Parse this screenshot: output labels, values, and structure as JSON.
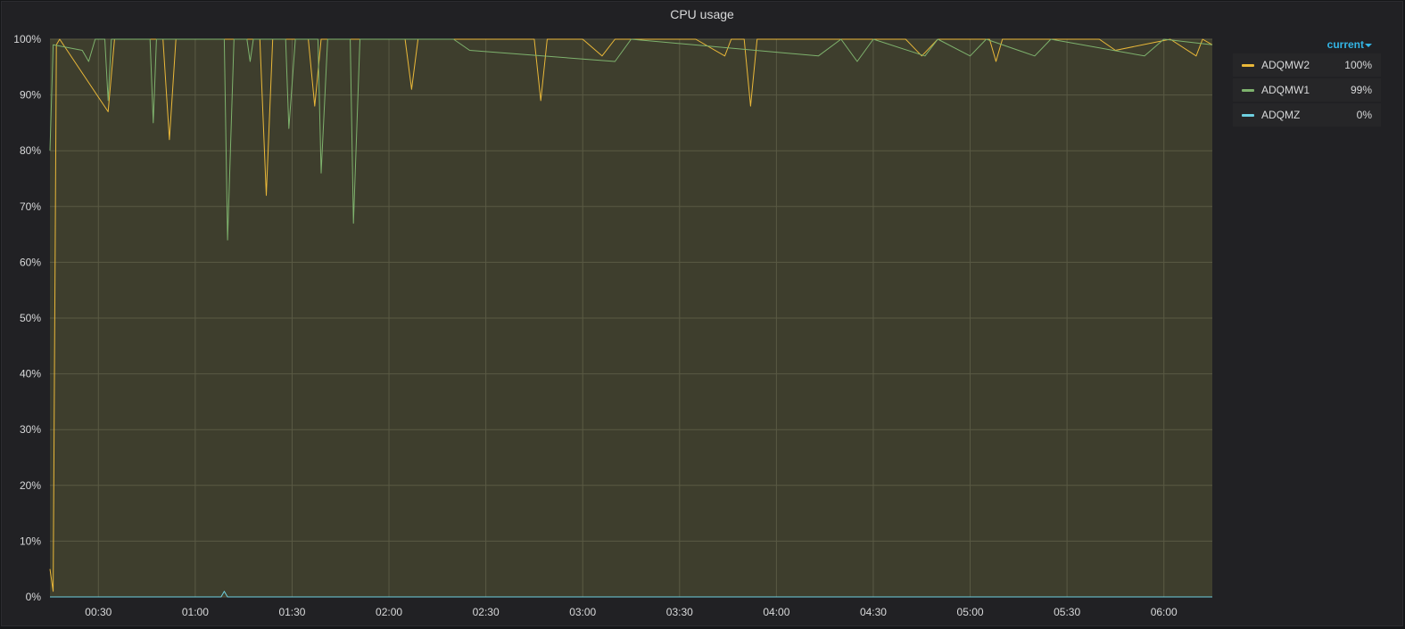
{
  "panel": {
    "title": "CPU usage"
  },
  "legend": {
    "header": "current",
    "items": [
      {
        "name": "ADQMW2",
        "value": "100%",
        "color": "#eab839"
      },
      {
        "name": "ADQMW1",
        "value": "99%",
        "color": "#7eb26d"
      },
      {
        "name": "ADQMZ",
        "value": "0%",
        "color": "#6ed0e0"
      }
    ]
  },
  "chart_data": {
    "type": "line",
    "title": "CPU usage",
    "xlabel": "",
    "ylabel": "",
    "x_range": [
      "00:15",
      "06:15"
    ],
    "x_ticks": [
      "00:30",
      "01:00",
      "01:30",
      "02:00",
      "02:30",
      "03:00",
      "03:30",
      "04:00",
      "04:30",
      "05:00",
      "05:30",
      "06:00"
    ],
    "y_ticks": [
      "0%",
      "10%",
      "20%",
      "30%",
      "40%",
      "50%",
      "60%",
      "70%",
      "80%",
      "90%",
      "100%"
    ],
    "ylim": [
      0,
      100
    ],
    "grid": true,
    "legend_position": "right",
    "fill_color": "#3e3e2d",
    "series": [
      {
        "name": "ADQMW2",
        "color": "#eab839",
        "points": [
          [
            "00:15",
            5
          ],
          [
            "00:16",
            1
          ],
          [
            "00:17",
            99
          ],
          [
            "00:18",
            100
          ],
          [
            "00:33",
            87
          ],
          [
            "00:35",
            100
          ],
          [
            "00:50",
            100
          ],
          [
            "00:52",
            82
          ],
          [
            "00:54",
            100
          ],
          [
            "01:20",
            100
          ],
          [
            "01:22",
            72
          ],
          [
            "01:24",
            100
          ],
          [
            "01:35",
            100
          ],
          [
            "01:37",
            88
          ],
          [
            "01:39",
            100
          ],
          [
            "02:05",
            100
          ],
          [
            "02:07",
            91
          ],
          [
            "02:09",
            100
          ],
          [
            "02:45",
            100
          ],
          [
            "02:47",
            89
          ],
          [
            "02:49",
            100
          ],
          [
            "03:00",
            100
          ],
          [
            "03:06",
            97
          ],
          [
            "03:10",
            100
          ],
          [
            "03:35",
            100
          ],
          [
            "03:44",
            97
          ],
          [
            "03:46",
            100
          ],
          [
            "03:50",
            100
          ],
          [
            "03:52",
            88
          ],
          [
            "03:54",
            100
          ],
          [
            "04:40",
            100
          ],
          [
            "04:45",
            97
          ],
          [
            "04:50",
            100
          ],
          [
            "05:06",
            100
          ],
          [
            "05:08",
            96
          ],
          [
            "05:10",
            100
          ],
          [
            "05:40",
            100
          ],
          [
            "05:45",
            98
          ],
          [
            "06:02",
            100
          ],
          [
            "06:10",
            97
          ],
          [
            "06:12",
            100
          ],
          [
            "06:15",
            99
          ]
        ]
      },
      {
        "name": "ADQMW1",
        "color": "#7eb26d",
        "points": [
          [
            "00:15",
            80
          ],
          [
            "00:16",
            99
          ],
          [
            "00:25",
            98
          ],
          [
            "00:27",
            96
          ],
          [
            "00:29",
            100
          ],
          [
            "00:32",
            100
          ],
          [
            "00:33",
            89
          ],
          [
            "00:34",
            100
          ],
          [
            "00:46",
            100
          ],
          [
            "00:47",
            85
          ],
          [
            "00:48",
            100
          ],
          [
            "01:09",
            100
          ],
          [
            "01:10",
            64
          ],
          [
            "01:12",
            100
          ],
          [
            "01:16",
            100
          ],
          [
            "01:17",
            96
          ],
          [
            "01:18",
            100
          ],
          [
            "01:28",
            100
          ],
          [
            "01:29",
            84
          ],
          [
            "01:31",
            100
          ],
          [
            "01:38",
            100
          ],
          [
            "01:39",
            76
          ],
          [
            "01:41",
            100
          ],
          [
            "01:48",
            100
          ],
          [
            "01:49",
            67
          ],
          [
            "01:51",
            100
          ],
          [
            "02:20",
            100
          ],
          [
            "02:25",
            98
          ],
          [
            "03:10",
            96
          ],
          [
            "03:15",
            100
          ],
          [
            "04:13",
            97
          ],
          [
            "04:20",
            100
          ],
          [
            "04:25",
            96
          ],
          [
            "04:30",
            100
          ],
          [
            "04:46",
            97
          ],
          [
            "04:50",
            100
          ],
          [
            "05:00",
            97
          ],
          [
            "05:05",
            100
          ],
          [
            "05:20",
            97
          ],
          [
            "05:25",
            100
          ],
          [
            "05:54",
            97
          ],
          [
            "06:00",
            100
          ],
          [
            "06:15",
            99
          ]
        ]
      },
      {
        "name": "ADQMZ",
        "color": "#6ed0e0",
        "points": [
          [
            "00:15",
            0
          ],
          [
            "01:08",
            0
          ],
          [
            "01:09",
            1
          ],
          [
            "01:10",
            0
          ],
          [
            "06:15",
            0
          ]
        ]
      }
    ]
  }
}
